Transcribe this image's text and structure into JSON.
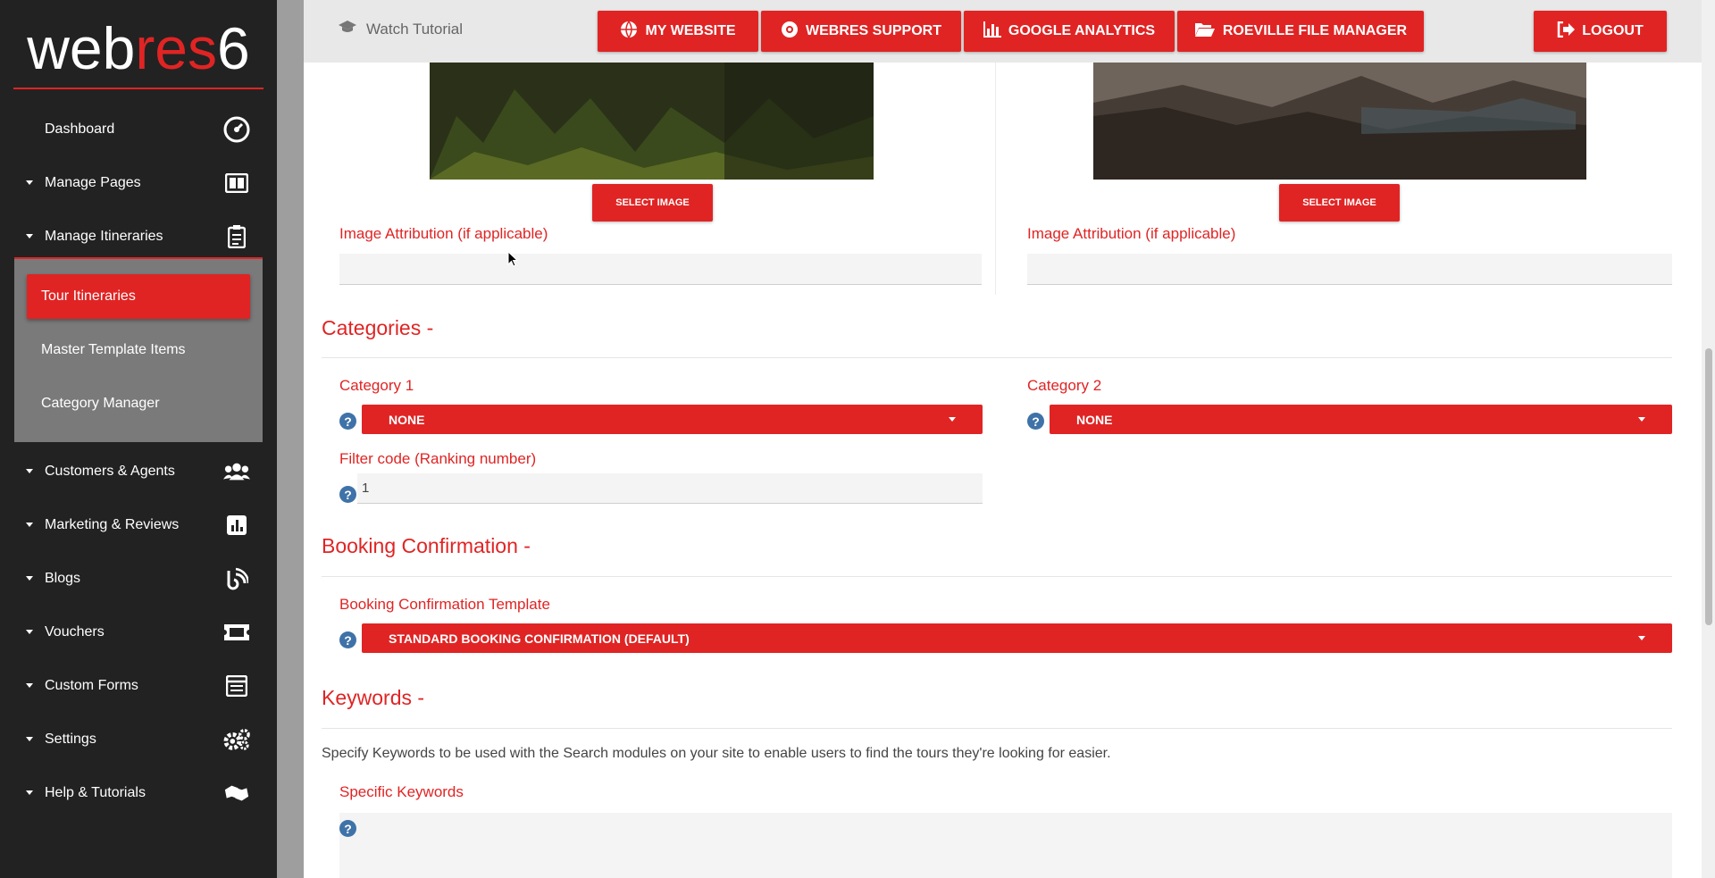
{
  "app": {
    "logo_part1": "web",
    "logo_part2": "res",
    "logo_part3": "6"
  },
  "sidebar": {
    "items": [
      {
        "label": "Dashboard",
        "icon": "dashboard-icon",
        "has_caret": false
      },
      {
        "label": "Manage Pages",
        "icon": "pages-icon",
        "has_caret": true
      },
      {
        "label": "Manage Itineraries",
        "icon": "clipboard-icon",
        "has_caret": true
      },
      {
        "label": "Customers & Agents",
        "icon": "users-icon",
        "has_caret": true
      },
      {
        "label": "Marketing & Reviews",
        "icon": "chart-icon",
        "has_caret": true
      },
      {
        "label": "Blogs",
        "icon": "blog-icon",
        "has_caret": true
      },
      {
        "label": "Vouchers",
        "icon": "ticket-icon",
        "has_caret": true
      },
      {
        "label": "Custom Forms",
        "icon": "form-icon",
        "has_caret": true
      },
      {
        "label": "Settings",
        "icon": "gears-icon",
        "has_caret": true
      },
      {
        "label": "Help & Tutorials",
        "icon": "handshake-icon",
        "has_caret": true
      }
    ],
    "submenu": [
      {
        "label": "Tour Itineraries",
        "active": true
      },
      {
        "label": "Master Template Items",
        "active": false
      },
      {
        "label": "Category Manager",
        "active": false
      }
    ]
  },
  "topbar": {
    "watch_tutorial": "Watch Tutorial",
    "buttons": [
      {
        "label": "MY WEBSITE",
        "icon": "globe-icon"
      },
      {
        "label": "WEBRES SUPPORT",
        "icon": "lifebuoy-icon"
      },
      {
        "label": "GOOGLE ANALYTICS",
        "icon": "bar-chart-icon"
      },
      {
        "label": "ROEVILLE FILE MANAGER",
        "icon": "folder-open-icon"
      },
      {
        "label": "LOGOUT",
        "icon": "logout-icon"
      }
    ]
  },
  "images": {
    "select_image_label": "SELECT IMAGE",
    "attribution_label": "Image Attribution (if applicable)",
    "attribution_left_value": "",
    "attribution_right_value": ""
  },
  "categories": {
    "heading": "Categories -",
    "category1_label": "Category 1",
    "category1_value": "NONE",
    "category2_label": "Category 2",
    "category2_value": "NONE",
    "filter_label": "Filter code (Ranking number)",
    "filter_value": "1"
  },
  "booking": {
    "heading": "Booking Confirmation -",
    "template_label": "Booking Confirmation Template",
    "template_value": "STANDARD BOOKING CONFIRMATION (DEFAULT)"
  },
  "keywords": {
    "heading": "Keywords -",
    "description": "Specify Keywords to be used with the Search modules on your site to enable users to find the tours they're looking for easier.",
    "specific_label": "Specific Keywords",
    "specific_value": ""
  },
  "help_glyph": "?",
  "colors": {
    "accent": "#e02424",
    "sidebar_bg": "#222222",
    "submenu_bg": "#7a7a7a",
    "help_blue": "#3f72a8"
  }
}
